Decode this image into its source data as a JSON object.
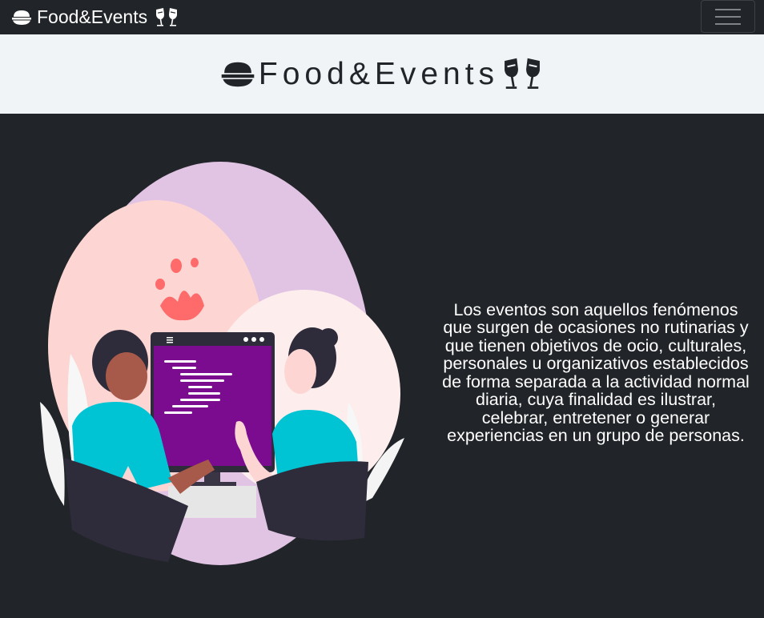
{
  "navbar": {
    "brand_text": "Food&Events",
    "toggler_icon": "hamburger-icon"
  },
  "hero": {
    "title": "Food&Events",
    "left_icon": "food-bowl-icon",
    "right_icon": "toast-glasses-icon"
  },
  "main": {
    "illustration": "two-people-coding-illustration",
    "description": "Los eventos son aquellos fenómenos que surgen de ocasiones no rutinarias y que tienen objetivos de ocio, culturales, personales u organizativos establecidos de forma separada a la actividad normal diaria, cuya finalidad es ilustrar, celebrar, entretener o generar experiencias en un grupo de personas."
  },
  "colors": {
    "background": "#212529",
    "title_band": "#f1f4f7",
    "screen": "#7b0c8f",
    "teal": "#00c4d4"
  }
}
